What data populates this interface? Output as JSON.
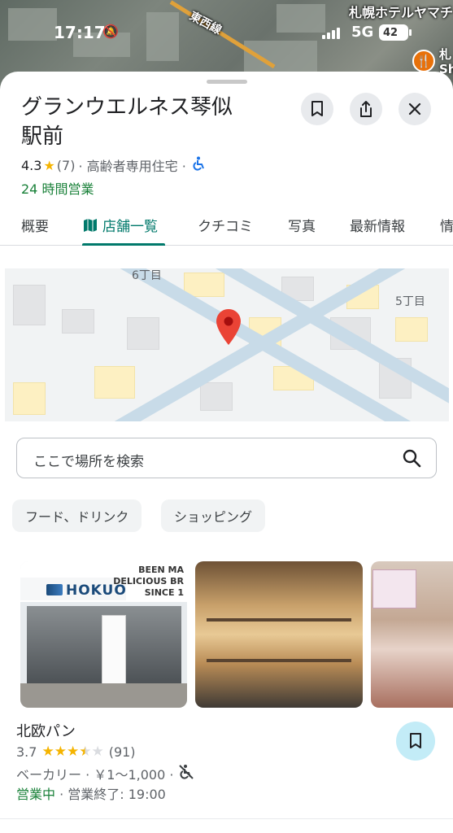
{
  "status_bar": {
    "time": "17:17",
    "network": "5G",
    "battery": "42"
  },
  "background_map": {
    "road_label": "東西線",
    "hotel_label": "札幌ホテルヤマチ",
    "poi_label": "札\nSh"
  },
  "place": {
    "name_line1": "グランウエルネス琴似",
    "name_line2": "駅前",
    "rating": "4.3",
    "review_count": "(7)",
    "category": "· 高齢者専用住宅 ·",
    "hours": "24 時間営業"
  },
  "tabs": [
    {
      "label": "概要"
    },
    {
      "label": "店舗一覧",
      "active": true
    },
    {
      "label": "クチコミ"
    },
    {
      "label": "写真"
    },
    {
      "label": "最新情報"
    },
    {
      "label": "情"
    }
  ],
  "mini_map": {
    "label_top": "6丁目",
    "label_right": "5丁目"
  },
  "search": {
    "placeholder": "ここで場所を検索"
  },
  "chips": [
    {
      "label": "フード、ドリンク"
    },
    {
      "label": "ショッピング"
    }
  ],
  "photo1": {
    "brand": "HOKUO",
    "tagline": "BEEN MA\nDELICIOUS BR\nSINCE 1"
  },
  "listing": {
    "name": "北欧パン",
    "rating": "3.7",
    "rating_value": 3.7,
    "review_count": "(91)",
    "category": "ベーカリー · ￥1～1,000 ·",
    "open_status": "営業中",
    "close_info": " · 営業終了: 19:00"
  },
  "colors": {
    "accent": "#00796b",
    "open_green": "#188038",
    "star": "#f5b400",
    "save_fab": "#c3ecf7"
  }
}
